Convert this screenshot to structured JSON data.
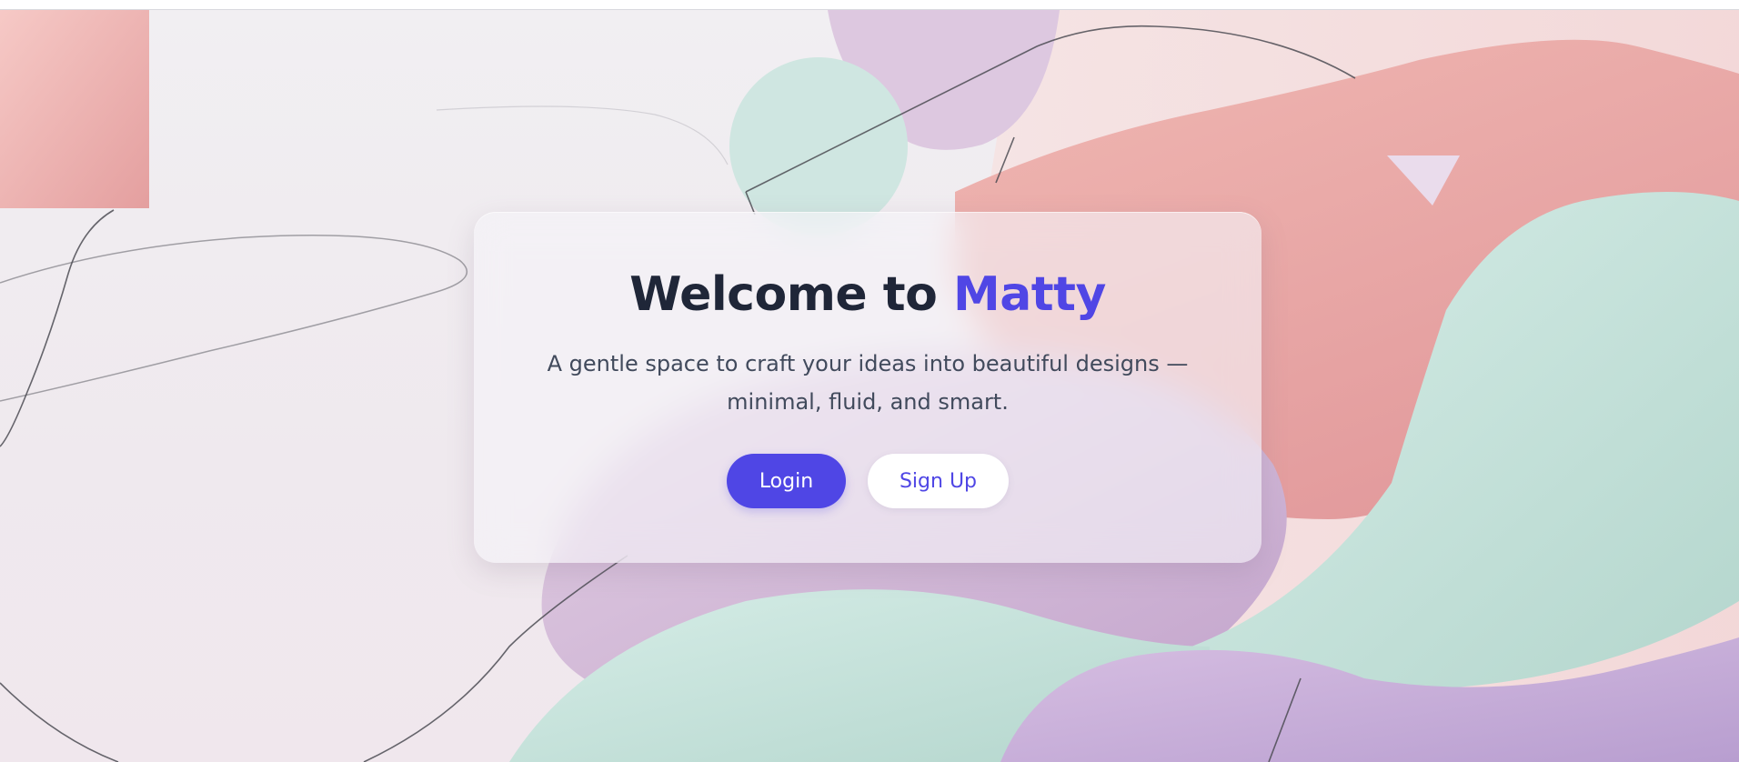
{
  "hero": {
    "title_prefix": "Welcome to",
    "title_brand": "Matty",
    "subtitle": "A gentle space to craft your ideas into beautiful designs — minimal, fluid, and smart."
  },
  "actions": {
    "login_label": "Login",
    "signup_label": "Sign Up"
  },
  "colors": {
    "brand": "#4f46e5",
    "title_text": "#1f2638",
    "body_text": "#414a5c",
    "card_background": "rgba(246,244,248,0.62)"
  }
}
